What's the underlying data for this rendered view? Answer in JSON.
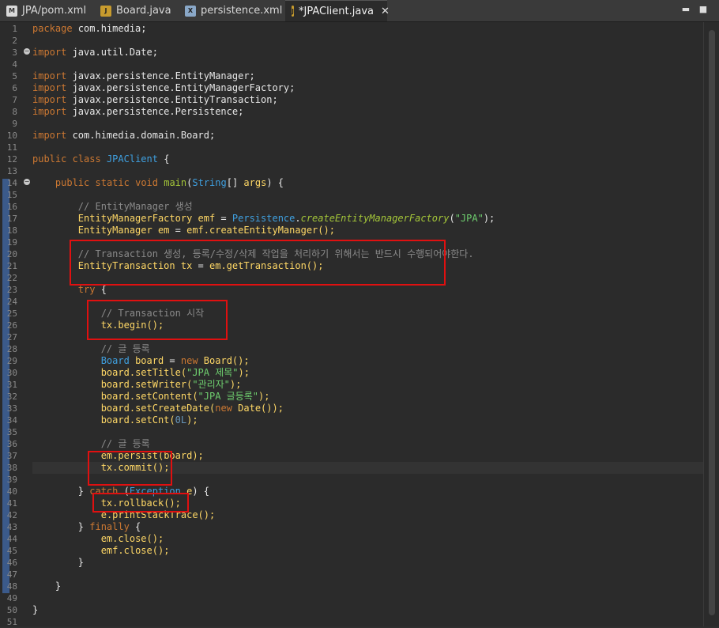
{
  "tabs": [
    {
      "label": "JPA/pom.xml",
      "icon": "maven-file-icon",
      "icon_text": "M"
    },
    {
      "label": "Board.java",
      "icon": "java-file-icon",
      "icon_text": "J"
    },
    {
      "label": "persistence.xml",
      "icon": "xml-file-icon",
      "icon_text": "X"
    },
    {
      "label": "*JPAClient.java",
      "icon": "java-file-icon",
      "icon_text": "J",
      "active": true,
      "close": "✕"
    }
  ],
  "window_controls": {
    "minimize": "▬",
    "maximize": "■"
  },
  "line_numbers": [
    "1",
    "2",
    "3",
    "4",
    "5",
    "6",
    "7",
    "8",
    "9",
    "10",
    "11",
    "12",
    "13",
    "14",
    "15",
    "16",
    "17",
    "18",
    "19",
    "20",
    "21",
    "22",
    "23",
    "24",
    "25",
    "26",
    "27",
    "28",
    "29",
    "30",
    "31",
    "32",
    "33",
    "34",
    "35",
    "36",
    "37",
    "38",
    "39",
    "40",
    "41",
    "42",
    "43",
    "44",
    "45",
    "46",
    "47",
    "48",
    "49",
    "50",
    "51"
  ],
  "code": {
    "l1_kw": "package",
    "l1_rest": " com.himedia;",
    "l3_kw": "import",
    "l3_rest": " java.util.Date;",
    "l5_kw": "import",
    "l5_rest": " javax.persistence.EntityManager;",
    "l6_kw": "import",
    "l6_rest": " javax.persistence.EntityManagerFactory;",
    "l7_kw": "import",
    "l7_rest": " javax.persistence.EntityTransaction;",
    "l8_kw": "import",
    "l8_rest": " javax.persistence.Persistence;",
    "l10_kw": "import",
    "l10_rest": " com.himedia.domain.Board;",
    "l12_kw1": "public",
    "l12_kw2": "class",
    "l12_type": "JPAClient",
    "l12_rest": " {",
    "l14_kw1": "public",
    "l14_kw2": "static",
    "l14_kw3": "void",
    "l14_fn": "main",
    "l14_p1": "(",
    "l14_type": "String",
    "l14_p2": "[] ",
    "l14_var": "args",
    "l14_p3": ") {",
    "l16_cm": "// EntityManager 생성",
    "l17_a": "EntityManagerFactory ",
    "l17_var": "emf",
    "l17_b": " = ",
    "l17_type": "Persistence",
    "l17_c": ".",
    "l17_it": "createEntityManagerFactory",
    "l17_d": "(",
    "l17_st": "\"JPA\"",
    "l17_e": ");",
    "l18_a": "EntityManager ",
    "l18_var": "em",
    "l18_b": " = ",
    "l18_v2": "emf",
    "l18_c": ".createEntityManager();",
    "l20_cm": "// Transaction 생성, 등록/수정/삭제 작업을 처리하기 위해서는 반드시 수행되어야한다.",
    "l21_a": "EntityTransaction ",
    "l21_var": "tx",
    "l21_b": " = ",
    "l21_v2": "em",
    "l21_c": ".getTransaction();",
    "l23_kw": "try",
    "l23_rest": " {",
    "l25_cm": "// Transaction 시작",
    "l26_var": "tx",
    "l26_rest": ".begin();",
    "l28_cm": "// 글 등록",
    "l29_type": "Board",
    "l29_sp": " ",
    "l29_var": "board",
    "l29_eq": " = ",
    "l29_kw": "new",
    "l29_sp2": " ",
    "l29_type2": "Board",
    "l29_rest": "();",
    "l30_var": "board",
    "l30_dot": ".",
    "l30_fn": "setTitle",
    "l30_p": "(",
    "l30_st": "\"JPA 제목\"",
    "l30_e": ");",
    "l31_var": "board",
    "l31_dot": ".",
    "l31_fn": "setWriter",
    "l31_p": "(",
    "l31_st": "\"관리자\"",
    "l31_e": ");",
    "l32_var": "board",
    "l32_dot": ".",
    "l32_fn": "setContent",
    "l32_p": "(",
    "l32_st": "\"JPA 글등록\"",
    "l32_e": ");",
    "l33_var": "board",
    "l33_dot": ".",
    "l33_fn": "setCreateDate",
    "l33_p": "(",
    "l33_kw": "new",
    "l33_sp": " ",
    "l33_type": "Date",
    "l33_e": "());",
    "l34_var": "board",
    "l34_dot": ".",
    "l34_fn": "setCnt",
    "l34_p": "(",
    "l34_num": "0L",
    "l34_e": ");",
    "l36_cm": "// 글 등록",
    "l37_var": "em",
    "l37_dot": ".",
    "l37_fn": "persist",
    "l37_p": "(",
    "l37_v2": "board",
    "l37_e": ");",
    "l38_var": "tx",
    "l38_dot": ".",
    "l38_fn": "commit",
    "l38_e": "();",
    "l40_a": "} ",
    "l40_kw": "catch",
    "l40_b": " (",
    "l40_type": "Exception",
    "l40_sp": " ",
    "l40_var": "e",
    "l40_c": ") {",
    "l41_var": "tx",
    "l41_dot": ".",
    "l41_fn": "rollback",
    "l41_e": "();",
    "l42_var": "e",
    "l42_dot": ".",
    "l42_fn": "printStackTrace",
    "l42_e": "();",
    "l43_a": "} ",
    "l43_kw": "finally",
    "l43_b": " {",
    "l44_var": "em",
    "l44_dot": ".",
    "l44_fn": "close",
    "l44_e": "();",
    "l45_var": "emf",
    "l45_dot": ".",
    "l45_fn": "close",
    "l45_e": "();",
    "l46": "}",
    "l48": "}",
    "l50": "}"
  },
  "colors": {
    "keyword": "#cc7832",
    "type": "#3fa0e0",
    "method": "#a4c639",
    "variable": "#ffd866",
    "string": "#6fcf6f",
    "comment": "#8a8a8a",
    "highlight_box": "#e01010"
  }
}
